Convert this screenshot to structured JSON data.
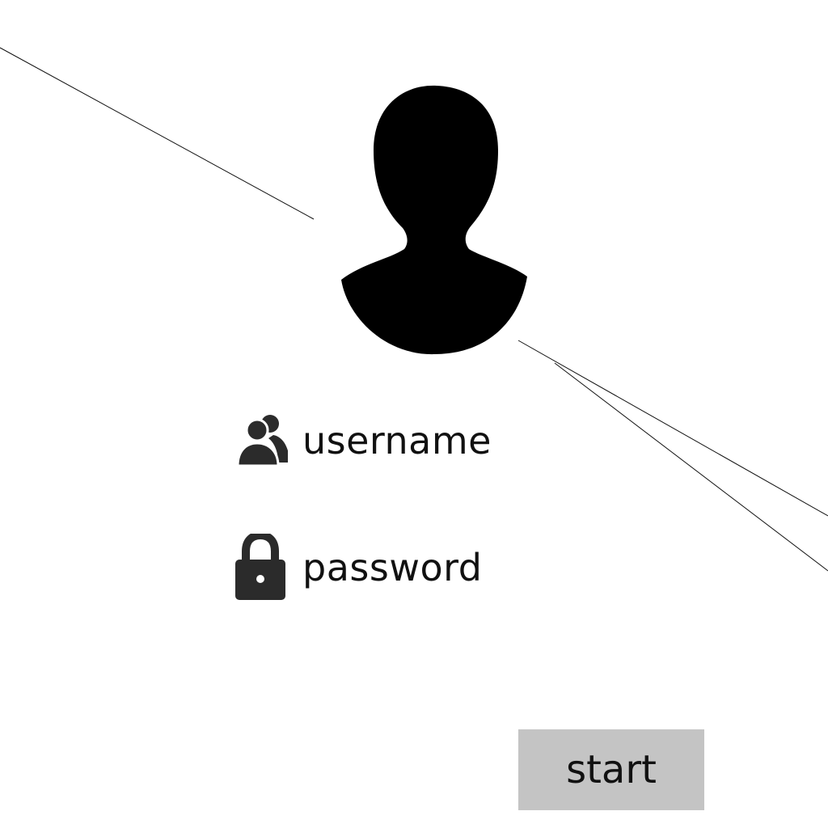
{
  "avatar": {
    "icon": "user-silhouette-icon",
    "color": "#000000"
  },
  "form": {
    "username": {
      "icon": "user-group-icon",
      "label": "username"
    },
    "password": {
      "icon": "lock-icon",
      "label": "password"
    }
  },
  "start_button": {
    "label": "start",
    "background": "#c4c4c4"
  }
}
